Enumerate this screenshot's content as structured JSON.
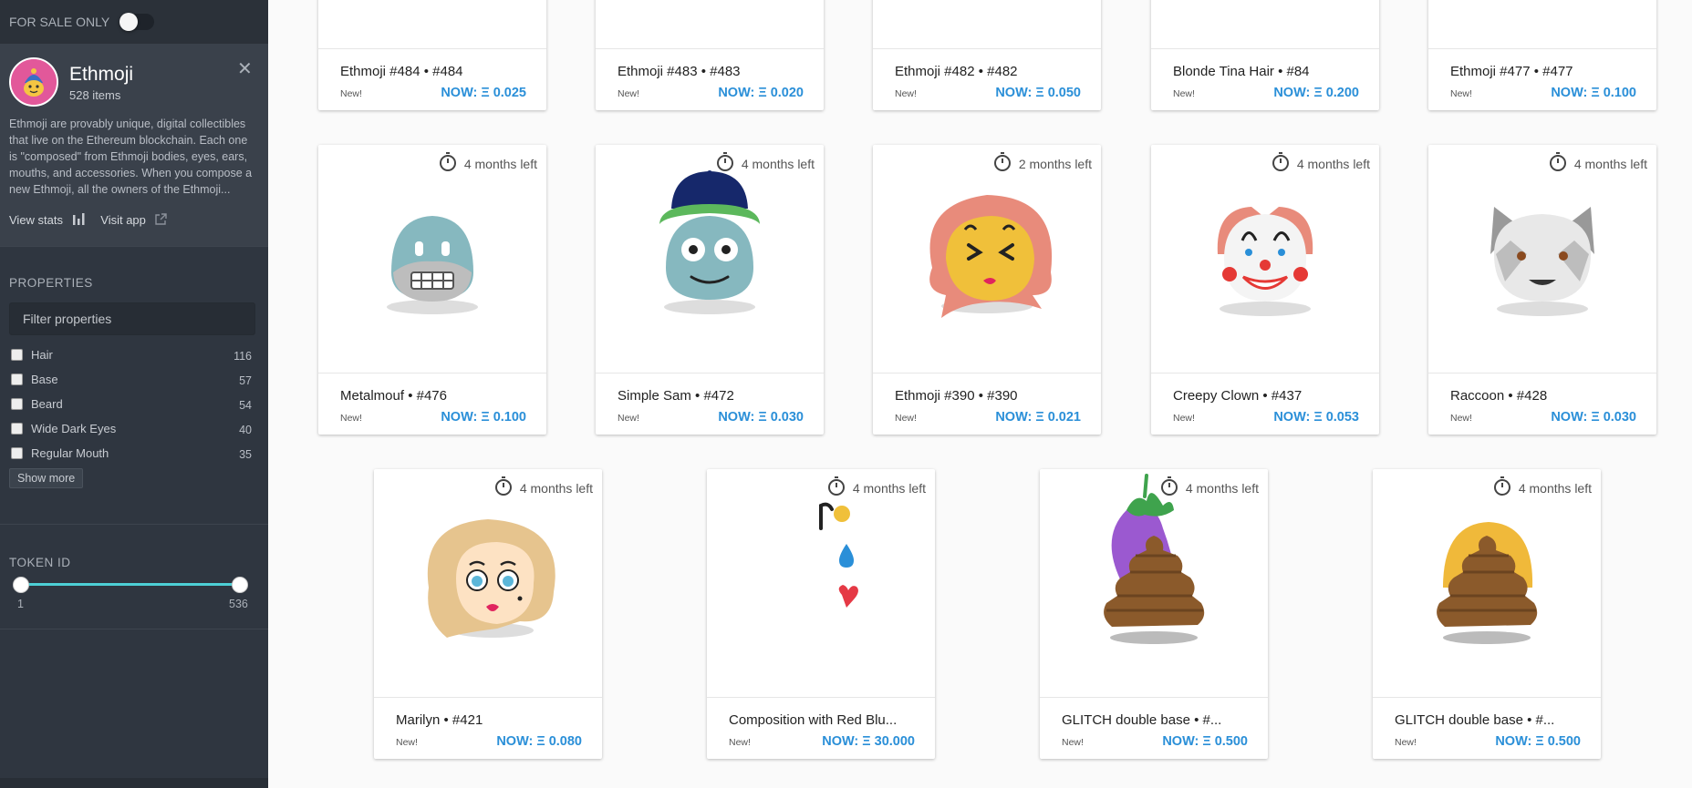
{
  "sidebar": {
    "for_sale_label": "FOR SALE ONLY",
    "for_sale_on": false,
    "collection": {
      "title": "Ethmoji",
      "count": "528 items",
      "description": "Ethmoji are provably unique, digital collectibles that live on the Ethereum blockchain. Each one is \"composed\" from Ethmoji bodies, eyes, ears, mouths, and accessories. When you compose a new Ethmoji, all the owners of the Ethmoji...",
      "view_stats": "View stats",
      "visit_app": "Visit app"
    },
    "properties": {
      "title": "PROPERTIES",
      "filter_placeholder": "Filter properties",
      "items": [
        {
          "label": "Hair",
          "count": "116"
        },
        {
          "label": "Base",
          "count": "57"
        },
        {
          "label": "Beard",
          "count": "54"
        },
        {
          "label": "Wide Dark Eyes",
          "count": "40"
        },
        {
          "label": "Regular Mouth",
          "count": "35"
        }
      ],
      "show_more": "Show more"
    },
    "token_id": {
      "title": "TOKEN ID",
      "min": "1",
      "max": "536"
    }
  },
  "currency_symbol": "Ξ",
  "new_label": "New!",
  "row1": [
    {
      "name": "Ethmoji #484  •  #484",
      "price": "NOW: Ξ 0.025"
    },
    {
      "name": "Ethmoji #483  •  #483",
      "price": "NOW: Ξ 0.020"
    },
    {
      "name": "Ethmoji #482  •  #482",
      "price": "NOW: Ξ 0.050"
    },
    {
      "name": "Blonde Tina Hair  •  #84",
      "price": "NOW: Ξ 0.200"
    },
    {
      "name": "Ethmoji #477  •  #477",
      "price": "NOW: Ξ 0.100"
    }
  ],
  "row2": [
    {
      "name": "Metalmouf  •  #476",
      "price": "NOW: Ξ 0.100",
      "timer": "4 months left"
    },
    {
      "name": "Simple Sam  •  #472",
      "price": "NOW: Ξ 0.030",
      "timer": "4 months left"
    },
    {
      "name": "Ethmoji #390  •  #390",
      "price": "NOW: Ξ 0.021",
      "timer": "2 months left"
    },
    {
      "name": "Creepy Clown  •  #437",
      "price": "NOW: Ξ 0.053",
      "timer": "4 months left"
    },
    {
      "name": "Raccoon  •  #428",
      "price": "NOW: Ξ 0.030",
      "timer": "4 months left"
    }
  ],
  "row3": [
    {
      "name": "Marilyn  •  #421",
      "price": "NOW: Ξ 0.080",
      "timer": "4 months left"
    },
    {
      "name": "Composition with Red Blu...",
      "price": "NOW: Ξ 30.000",
      "timer": "4 months left"
    },
    {
      "name": "GLITCH double base  •  #...",
      "price": "NOW: Ξ 0.500",
      "timer": "4 months left"
    },
    {
      "name": "GLITCH double base  •  #...",
      "price": "NOW: Ξ 0.500",
      "timer": "4 months left"
    }
  ],
  "colors": {
    "sidebar_bg": "#2f3640",
    "price_blue": "#2a8fd8",
    "slider_accent": "#4dd0d6"
  }
}
